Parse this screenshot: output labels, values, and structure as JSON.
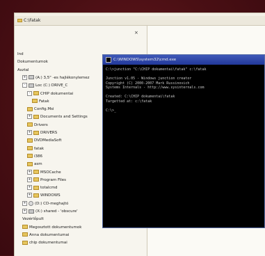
{
  "explorer": {
    "address": "C:\\Fatak",
    "close_glyph": "×",
    "tree": [
      {
        "label": "Ind",
        "indent": 0,
        "icon": "none",
        "expander": ""
      },
      {
        "label": "Dokumentumok",
        "indent": 0,
        "icon": "none",
        "expander": ""
      },
      {
        "label": "Asztal",
        "indent": 0,
        "icon": "none",
        "expander": ""
      },
      {
        "label": "(A:) 3,5\" -es hajlékonylemez",
        "indent": 1,
        "icon": "drive",
        "expander": "+"
      },
      {
        "label": "Loc (C:) DRIVE_C",
        "indent": 1,
        "icon": "drive",
        "expander": "-"
      },
      {
        "label": "CHIP dokumentai",
        "indent": 2,
        "icon": "folder",
        "expander": "-"
      },
      {
        "label": "Fatak",
        "indent": 3,
        "icon": "folder",
        "expander": ""
      },
      {
        "label": "Config.Msi",
        "indent": 2,
        "icon": "folder",
        "expander": ""
      },
      {
        "label": "Documents and Settings",
        "indent": 2,
        "icon": "folder",
        "expander": "+"
      },
      {
        "label": "Drivers",
        "indent": 2,
        "icon": "folder",
        "expander": ""
      },
      {
        "label": "DRIVERS",
        "indent": 2,
        "icon": "folder",
        "expander": "+"
      },
      {
        "label": "DVDMediaSoft",
        "indent": 2,
        "icon": "folder",
        "expander": ""
      },
      {
        "label": "fatak",
        "indent": 2,
        "icon": "folder",
        "expander": ""
      },
      {
        "label": "i386",
        "indent": 2,
        "icon": "folder",
        "expander": ""
      },
      {
        "label": "asm",
        "indent": 2,
        "icon": "folder",
        "expander": ""
      },
      {
        "label": "MSOCache",
        "indent": 2,
        "icon": "folder",
        "expander": "+"
      },
      {
        "label": "Program Files",
        "indent": 2,
        "icon": "folder",
        "expander": "+"
      },
      {
        "label": "totalcmd",
        "indent": 2,
        "icon": "folder",
        "expander": "+"
      },
      {
        "label": "WINDOWS",
        "indent": 2,
        "icon": "folder",
        "expander": "+"
      },
      {
        "label": "(D:) CD-meghajtó",
        "indent": 1,
        "icon": "cd",
        "expander": "+"
      },
      {
        "label": "(X:) shared - 'obscure'",
        "indent": 1,
        "icon": "drive",
        "expander": "+"
      },
      {
        "label": "Vezérlőpult",
        "indent": 1,
        "icon": "none",
        "expander": ""
      },
      {
        "label": "Megosztott dokumentumok",
        "indent": 1,
        "icon": "folder",
        "expander": ""
      },
      {
        "label": "Anna dokumentumai",
        "indent": 1,
        "icon": "folder",
        "expander": ""
      },
      {
        "label": "chip dokumentumai",
        "indent": 1,
        "icon": "folder",
        "expander": ""
      }
    ]
  },
  "cmd": {
    "title": "C:\\WINDOWS\\system32\\cmd.exe",
    "lines": [
      "C:\\>junction \"C:\\CHIP dokumentai\\fatak\" c:\\fatak",
      "",
      "Junction v1.05 - Windows junction creator",
      "Copyright (C) 2000-2007 Mark Russinovich",
      "Systems Internals - http://www.sysinternals.com",
      "",
      "Created: C:\\CHIP dokumentai\\fatak",
      "Targetted at: c:\\fatak",
      "",
      "C:\\>_"
    ]
  }
}
